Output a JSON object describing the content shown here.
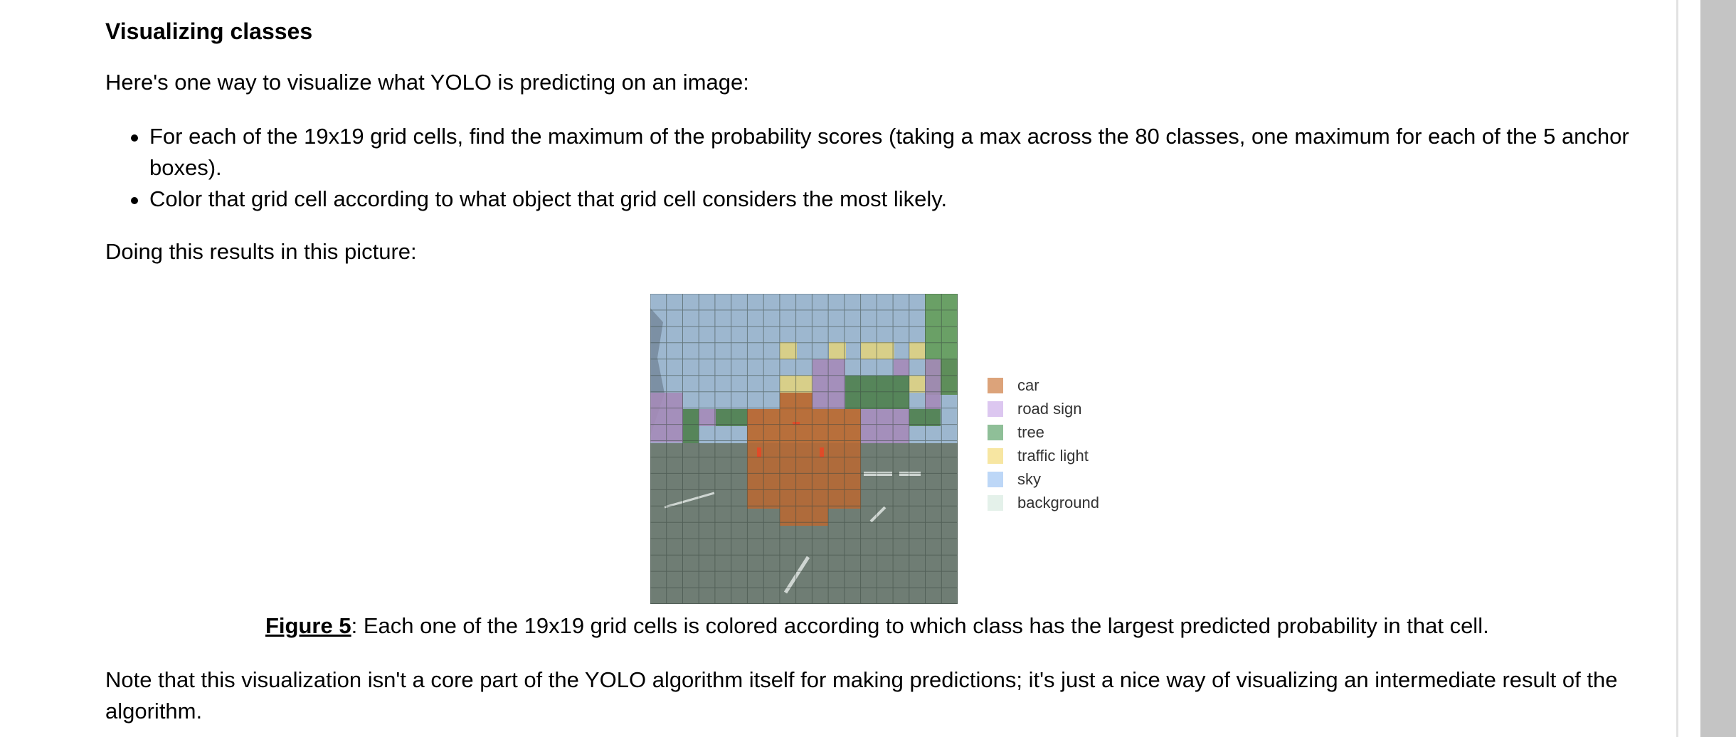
{
  "heading": "Visualizing classes",
  "intro": "Here's one way to visualize what YOLO is predicting on an image:",
  "bullets": [
    "For each of the 19x19 grid cells, find the maximum of the probability scores (taking a max across the 80 classes, one maximum for each of the 5 anchor boxes).",
    "Color that grid cell according to what object that grid cell considers the most likely."
  ],
  "doing": "Doing this results in this picture:",
  "figure": {
    "legend": [
      {
        "label": "car",
        "color": "#dca37a"
      },
      {
        "label": "road sign",
        "color": "#dcc7f0"
      },
      {
        "label": "tree",
        "color": "#8fbf98"
      },
      {
        "label": "traffic light",
        "color": "#f7e6a2"
      },
      {
        "label": "sky",
        "color": "#bdd7f7"
      },
      {
        "label": "background",
        "color": "#e4f1ea"
      }
    ],
    "caption_label": "Figure 5",
    "caption_text": ": Each one of the 19x19 grid cells is colored according to which class has the largest predicted probability in that cell."
  },
  "note": "Note that this visualization isn't a core part of the YOLO algorithm itself for making predictions; it's just a nice way of visualizing an intermediate result of the algorithm."
}
